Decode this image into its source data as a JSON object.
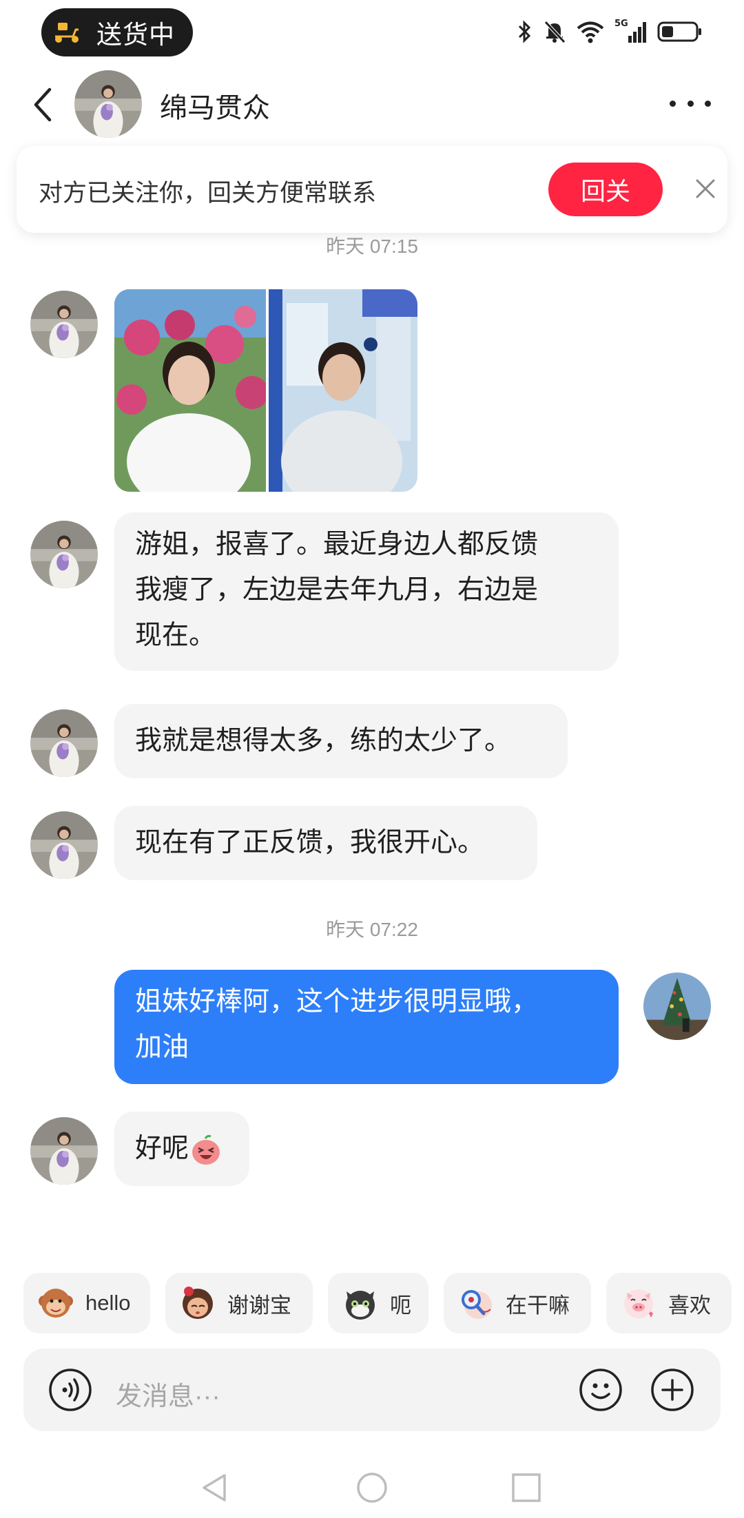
{
  "status_bar": {
    "delivery_label": "送货中",
    "network_label": "5G"
  },
  "header": {
    "contact_name": "绵马贯众"
  },
  "follow_banner": {
    "message": "对方已关注你，回关方便常联系",
    "button_label": "回关"
  },
  "timestamps": [
    "昨天 07:15",
    "昨天 07:22"
  ],
  "messages": [
    {
      "direction": "in",
      "type": "image"
    },
    {
      "direction": "in",
      "type": "text",
      "lines": [
        "游姐，报喜了。最近身边人都反馈",
        "我瘦了，左边是去年九月，右边是",
        "现在。"
      ]
    },
    {
      "direction": "in",
      "type": "text",
      "lines": [
        "我就是想得太多，练的太少了。"
      ]
    },
    {
      "direction": "in",
      "type": "text",
      "lines": [
        "现在有了正反馈，我很开心。"
      ]
    },
    {
      "direction": "out",
      "type": "text",
      "lines": [
        "姐妹好棒阿，这个进步很明显哦，",
        "加油"
      ]
    },
    {
      "direction": "in",
      "type": "text",
      "lines": [
        "好呢"
      ],
      "sticker": "laughing-face-sticker"
    }
  ],
  "quick_replies": [
    {
      "label": "hello",
      "icon": "monkey-sticker-icon"
    },
    {
      "label": "谢谢宝",
      "icon": "girl-rose-sticker-icon"
    },
    {
      "label": "呃",
      "icon": "cat-sticker-icon"
    },
    {
      "label": "在干嘛",
      "icon": "magnifier-sticker-icon"
    },
    {
      "label": "喜欢",
      "icon": "pig-sticker-icon"
    }
  ],
  "input": {
    "placeholder": "发消息···"
  },
  "colors": {
    "accent_red": "#ff2442",
    "outgoing_bubble": "#2d7ff9",
    "incoming_bubble": "#f4f4f4"
  }
}
